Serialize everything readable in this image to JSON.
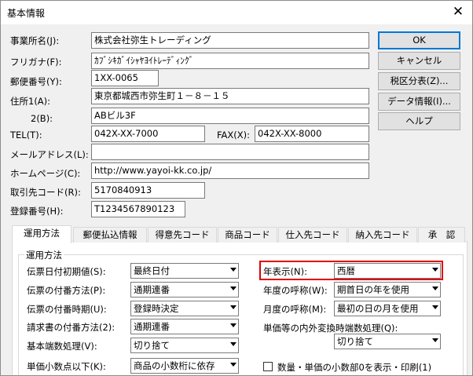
{
  "window": {
    "title": "基本情報",
    "close": "✕"
  },
  "fields": {
    "company_label": "事業所名(J):",
    "company_value": "株式会社弥生トレーディング",
    "kana_label": "フリガナ(F):",
    "kana_value": "ｶﾌﾞｼｷｶﾞｲｼｬﾔﾖｲﾄﾚｰﾃﾞｨﾝｸﾞ",
    "zip_label": "郵便番号(Y):",
    "zip_value": "1XX-0065",
    "addr1_label": "住所1(A):",
    "addr1_value": "東京都城西市弥生町１－８－１５",
    "addr2_label": "2(B):",
    "addr2_value": "ABビル3F",
    "tel_label": "TEL(T):",
    "tel_value": "042X-XX-7000",
    "fax_label": "FAX(X):",
    "fax_value": "042X-XX-8000",
    "mail_label": "メールアドレス(L):",
    "mail_value": "",
    "home_label": "ホームページ(C):",
    "home_value": "http://www.yayoi-kk.co.jp/",
    "code_label": "取引先コード(R):",
    "code_value": "5170840913",
    "reg_label": "登録番号(H):",
    "reg_value": "T1234567890123"
  },
  "buttons": {
    "ok": "OK",
    "cancel": "キャンセル",
    "tax": "税区分表(Z)...",
    "data": "データ情報(I)...",
    "help": "ヘルプ"
  },
  "tabs": [
    "運用方法",
    "郵便払込情報",
    "得意先コード",
    "商品コード",
    "仕入先コード",
    "納入先コード",
    "承　認"
  ],
  "panel": {
    "group_label": "運用方法",
    "left": [
      {
        "label": "伝票日付初期値(S):",
        "value": "最終日付"
      },
      {
        "label": "伝票の付番方法(P):",
        "value": "通期連番"
      },
      {
        "label": "伝票の付番時期(U):",
        "value": "登録時決定"
      },
      {
        "label": "請求書の付番方法(2):",
        "value": "通期連番"
      },
      {
        "label": "基本端数処理(V):",
        "value": "切り捨て"
      },
      {
        "label": "単価小数点以下(K):",
        "value": "商品の小数桁に依存"
      }
    ],
    "right": [
      {
        "label": "年表示(N):",
        "value": "西暦"
      },
      {
        "label": "年度の呼称(W):",
        "value": "期首日の年を使用"
      },
      {
        "label": "月度の呼称(M):",
        "value": "最初の日の月を使用"
      }
    ],
    "conv_label": "単価等の内外変換時端数処理(Q):",
    "conv_value": "切り捨て",
    "checkbox_label": "数量・単価の小数部0を表示・印刷(1)"
  }
}
